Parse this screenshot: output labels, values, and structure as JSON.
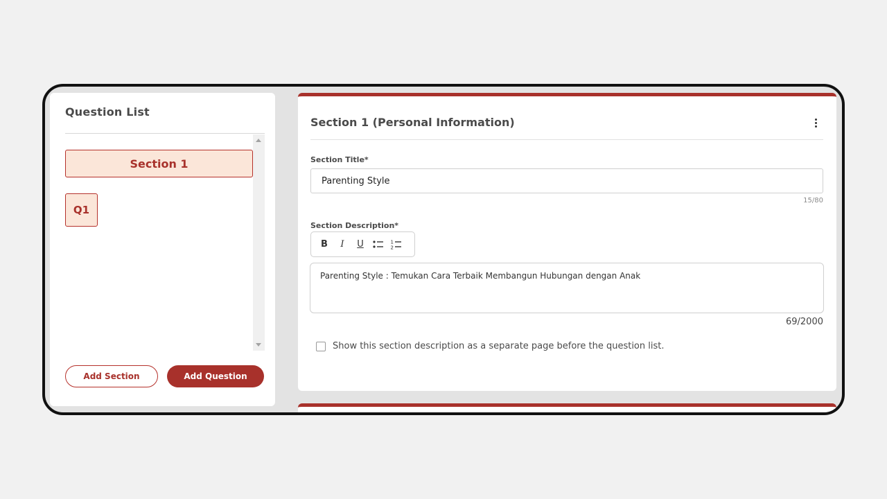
{
  "question_list": {
    "title": "Question List",
    "section_chip": "Section 1",
    "question_chip": "Q1",
    "add_section_label": "Add Section",
    "add_question_label": "Add Question"
  },
  "section_card": {
    "title": "Section 1 (Personal Information)",
    "section_title_label": "Section Title*",
    "section_title_value": "Parenting Style",
    "section_title_counter": "15/80",
    "section_description_label": "Section Description*",
    "toolbar": {
      "bold": "B",
      "italic": "I",
      "underline": "U",
      "bullet_list_icon": "bullet-list-icon",
      "numbered_list_icon": "numbered-list-icon"
    },
    "section_description_value": "Parenting Style : Temukan Cara Terbaik Membangun Hubungan dengan Anak",
    "section_description_counter": "69/2000",
    "separate_page_checkbox_label": "Show this section description as a separate page before the question list.",
    "separate_page_checked": false
  },
  "colors": {
    "accent": "#a8312b",
    "chip_bg": "#fbe6d9",
    "page_bg": "#f1f1f1"
  }
}
